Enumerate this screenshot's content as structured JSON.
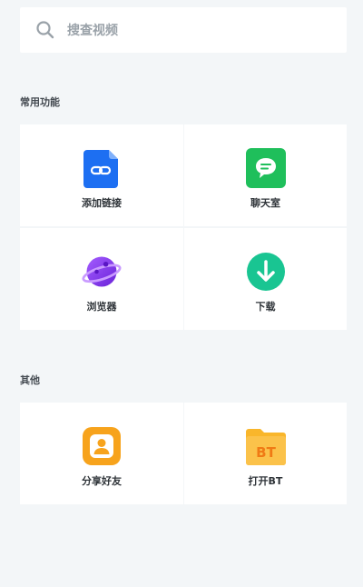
{
  "search": {
    "placeholder": "搜查视频",
    "icon": "search-icon"
  },
  "sections": [
    {
      "title": "常用功能",
      "items": [
        {
          "label": "添加链接",
          "icon": "link-icon",
          "color": "#1d6ff2"
        },
        {
          "label": "聊天室",
          "icon": "chat-icon",
          "color": "#1fbf5b"
        },
        {
          "label": "浏览器",
          "icon": "planet-icon",
          "color": "#8a3cf0"
        },
        {
          "label": "下载",
          "icon": "download-icon",
          "color": "#19c592"
        }
      ]
    },
    {
      "title": "其他",
      "items": [
        {
          "label": "分享好友",
          "icon": "user-card-icon",
          "color": "#f7a31c"
        },
        {
          "label": "打开BT",
          "icon": "bt-folder-icon",
          "color": "#f9b62b"
        }
      ]
    }
  ]
}
